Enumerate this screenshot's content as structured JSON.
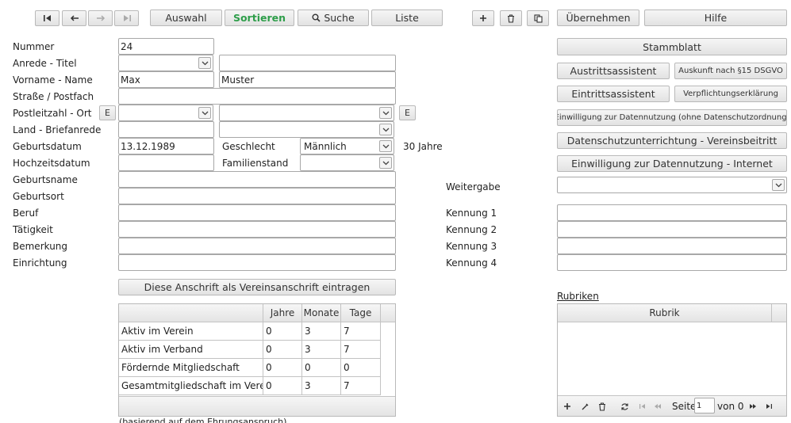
{
  "toolbar": {
    "first_icon": "first-record-icon",
    "prev_icon": "arrow-left-icon",
    "next_icon": "arrow-right-icon",
    "last_icon": "last-record-icon",
    "auswahl": "Auswahl",
    "sortieren": "Sortieren",
    "suche": "Suche",
    "liste": "Liste",
    "uebernehmen": "Übernehmen",
    "hilfe": "Hilfe"
  },
  "form": {
    "nummer_label": "Nummer",
    "nummer_value": "24",
    "anrede_label": "Anrede - Titel",
    "anrede_value": "",
    "titel_value": "",
    "name_label": "Vorname - Name",
    "vorname_value": "Max",
    "nachname_value": "Muster",
    "strasse_label": "Straße / Postfach",
    "strasse_value": "",
    "plz_label": "Postleitzahl - Ort",
    "e_button": "E",
    "plz_value": "",
    "ort_value": "",
    "land_label": "Land - Briefanrede",
    "land_value": "",
    "briefanrede_value": "",
    "geburtsdatum_label": "Geburtsdatum",
    "geburtsdatum_value": "13.12.1989",
    "geschlecht_label": "Geschlecht",
    "geschlecht_value": "Männlich",
    "alter": "30 Jahre",
    "hochzeit_label": "Hochzeitsdatum",
    "hochzeit_value": "",
    "familienstand_label": "Familienstand",
    "familienstand_value": "",
    "geburtsname_label": "Geburtsname",
    "geburtsort_label": "Geburtsort",
    "beruf_label": "Beruf",
    "taetigkeit_label": "Tätigkeit",
    "bemerkung_label": "Bemerkung",
    "einrichtung_label": "Einrichtung",
    "vereinsanschrift_button": "Diese Anschrift als Vereinsanschrift eintragen",
    "footnote": "(basierend auf dem Ehrungsanspruch)"
  },
  "membership_table": {
    "headers": [
      "",
      "Jahre",
      "Monate",
      "Tage"
    ],
    "rows": [
      {
        "label": "Aktiv im Verein",
        "jahre": "0",
        "monate": "3",
        "tage": "7"
      },
      {
        "label": "Aktiv im Verband",
        "jahre": "0",
        "monate": "3",
        "tage": "7"
      },
      {
        "label": "Fördernde Mitgliedschaft",
        "jahre": "0",
        "monate": "0",
        "tage": "0"
      },
      {
        "label": "Gesamtmitgliedschaft im Verein",
        "jahre": "0",
        "monate": "3",
        "tage": "7"
      }
    ]
  },
  "right": {
    "stammblatt": "Stammblatt",
    "austritt": "Austrittsassistent",
    "auskunft": "Auskunft nach §15 DSGVO",
    "eintritt": "Eintrittsassistent",
    "verpflichtung": "Verpflichtungserklärung",
    "einwilligung_ohne": "Einwilligung zur Datennutzung (ohne Datenschutzordnung)",
    "datenschutz": "Datenschutzunterrichtung - Vereinsbeitritt",
    "einwilligung_internet": "Einwilligung zur Datennutzung - Internet",
    "weitergabe_label": "Weitergabe",
    "weitergabe_value": "",
    "kennung1_label": "Kennung 1",
    "kennung2_label": "Kennung 2",
    "kennung3_label": "Kennung 3",
    "kennung4_label": "Kennung 4",
    "rubriken_link": "Rubriken",
    "rubrik_header": "Rubrik",
    "seite_label": "Seite",
    "seite_value": "1",
    "von_label": "von 0"
  }
}
